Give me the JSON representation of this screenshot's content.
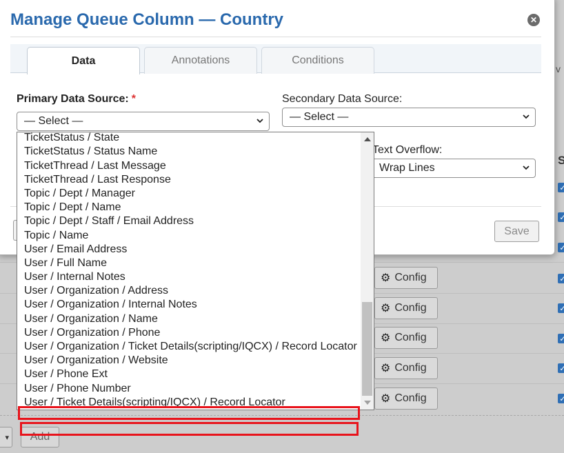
{
  "dialog": {
    "title": "Manage Queue Column — Country",
    "tabs": [
      {
        "label": "Data",
        "active": true
      },
      {
        "label": "Annotations",
        "active": false
      },
      {
        "label": "Conditions",
        "active": false
      }
    ],
    "primary_label": "Primary Data Source:",
    "required_mark": "*",
    "primary_value": "— Select —",
    "secondary_label": "Secondary Data Source:",
    "secondary_value": "— Select —",
    "text_overflow_label": "Text Overflow:",
    "text_overflow_value": "Wrap Lines",
    "save_label": "Save"
  },
  "dropdown": {
    "options": [
      "TicketStatus / State",
      "TicketStatus / Status Name",
      "TicketThread / Last Message",
      "TicketThread / Last Response",
      "Topic / Dept / Manager",
      "Topic / Dept / Name",
      "Topic / Dept / Staff / Email Address",
      "Topic / Name",
      "User / Email Address",
      "User / Full Name",
      "User / Internal Notes",
      "User / Organization / Address",
      "User / Organization / Internal Notes",
      "User / Organization / Name",
      "User / Organization / Phone",
      "User / Organization / Ticket Details(scripting/IQCX) / Record Locator",
      "User / Organization / Website",
      "User / Phone Ext",
      "User / Phone Number",
      "User / Ticket Details(scripting/IQCX) / Record Locator"
    ]
  },
  "background": {
    "config_label": "Config",
    "add_label": "Add",
    "column_header_initial": "S",
    "partial_v": "v"
  },
  "colors": {
    "title": "#2a69ad",
    "highlight": "#e8131b",
    "required": "#dd3333",
    "checkbox": "#2f6fb5"
  }
}
